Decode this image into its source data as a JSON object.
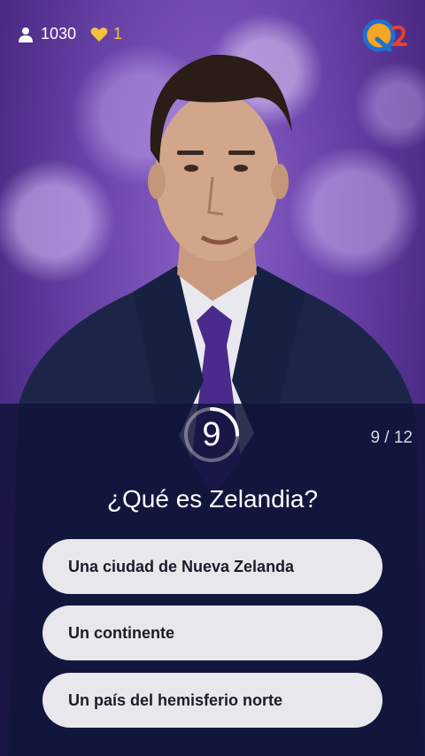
{
  "header": {
    "viewer_count": "1030",
    "lives_count": "1",
    "icons": {
      "viewers": "person-icon",
      "lives": "heart-icon",
      "logo": "q12-logo"
    }
  },
  "colors": {
    "lives": "#f3c33a",
    "panel": "#12143a",
    "answer_bg": "#e8e8ec",
    "logo_blue": "#1e6fd0",
    "logo_red": "#e8412c",
    "logo_orange": "#f5a623"
  },
  "quiz": {
    "timer": "9",
    "timer_remaining_fraction": 0.25,
    "progress": "9 / 12",
    "question": "¿Qué es Zelandia?",
    "answers": [
      "Una ciudad de Nueva Zelanda",
      "Un continente",
      "Un país del hemisferio norte"
    ]
  }
}
